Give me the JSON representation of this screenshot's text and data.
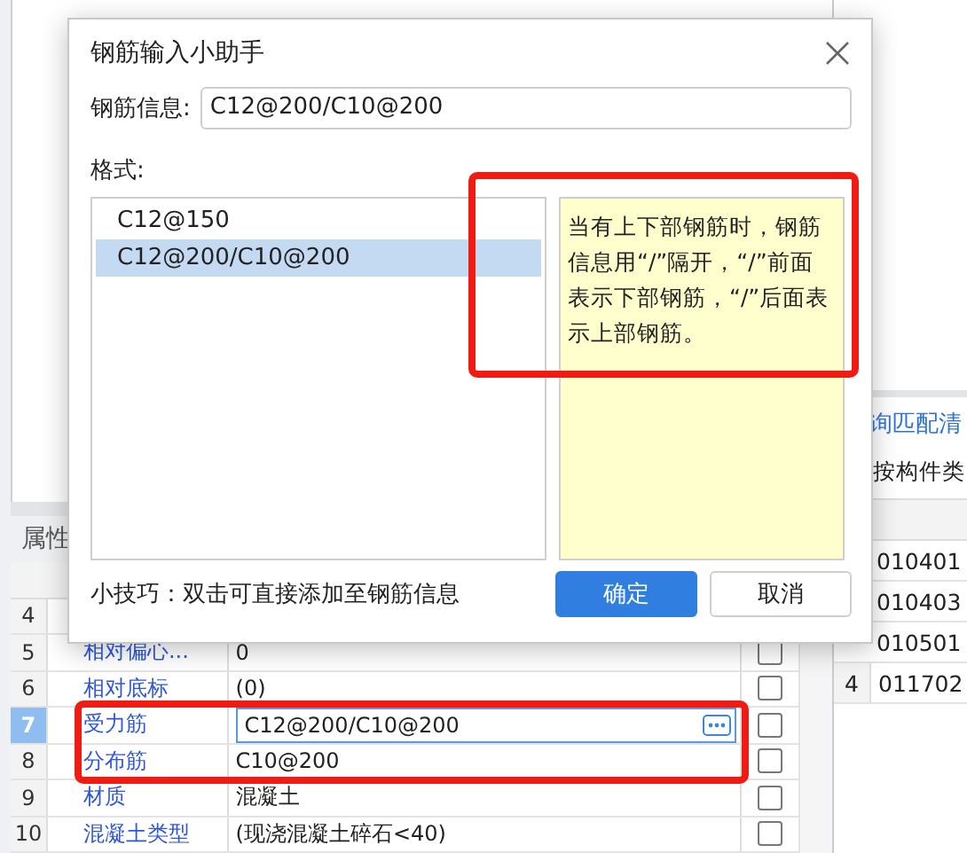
{
  "property_panel": {
    "tab": "属性",
    "rows": [
      {
        "number": "4",
        "selected": false
      },
      {
        "number": "5",
        "name": "相对偏心...",
        "value": "0",
        "selected": false,
        "checked": false
      },
      {
        "number": "6",
        "name": "相对底标",
        "value": "(0)",
        "selected": false,
        "checked": false
      },
      {
        "number": "7",
        "name": "受力筋",
        "value": "C12@200/C10@200",
        "selected": true,
        "checked": false
      },
      {
        "number": "8",
        "name": "分布筋",
        "value": "C10@200",
        "selected": false,
        "checked": false
      },
      {
        "number": "9",
        "name": "材质",
        "value": "混凝土",
        "selected": false,
        "checked": false
      },
      {
        "number": "10",
        "name": "混凝土类型",
        "value": "(现浇混凝土碎石<40)",
        "selected": false,
        "checked": false
      }
    ]
  },
  "right_panel": {
    "link": "询匹配清",
    "radio_label": "按构件类",
    "rows": [
      {
        "code": "010401"
      },
      {
        "code": "010403"
      },
      {
        "code": "010501"
      },
      {
        "number": "4",
        "code": "011702"
      }
    ]
  },
  "dialog": {
    "title": "钢筋输入小助手",
    "field_label": "钢筋信息:",
    "field_value": "C12@200/C10@200",
    "format_label": "格式:",
    "formats": [
      {
        "text": "C12@150",
        "selected": false
      },
      {
        "text": "C12@200/C10@200",
        "selected": true
      }
    ],
    "note": "当有上下部钢筋时，钢筋信息用“/”隔开，“/”前面表示下部钢筋，“/”后面表示上部钢筋。",
    "tip": "小技巧：双击可直接添加至钢筋信息",
    "buttons": [
      {
        "label": "确定",
        "kind": "primary"
      },
      {
        "label": "取消",
        "kind": "secondary"
      }
    ]
  }
}
